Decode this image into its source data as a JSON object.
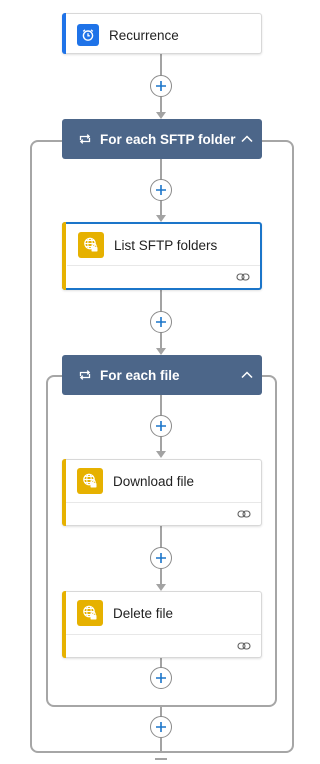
{
  "colors": {
    "trigger_accent": "#1f73e8",
    "action_accent": "#e6b100",
    "scope_header": "#4c6689",
    "selected_border": "#1b75c9",
    "connector": "#a3a3a3"
  },
  "trigger": {
    "label": "Recurrence",
    "icon": "clock-icon"
  },
  "outer_loop": {
    "label": "For each SFTP folder",
    "icon": "loop-icon",
    "collapse_icon": "chevron-up-icon",
    "actions": [
      {
        "label": "List SFTP folders",
        "icon": "sftp-icon",
        "selected": true
      }
    ]
  },
  "inner_loop": {
    "label": "For each file",
    "icon": "loop-icon",
    "collapse_icon": "chevron-up-icon",
    "actions": [
      {
        "label": "Download file",
        "icon": "sftp-icon"
      },
      {
        "label": "Delete file",
        "icon": "sftp-icon"
      }
    ]
  },
  "add_step_icon": "plus-icon",
  "link_icon": "link-icon"
}
